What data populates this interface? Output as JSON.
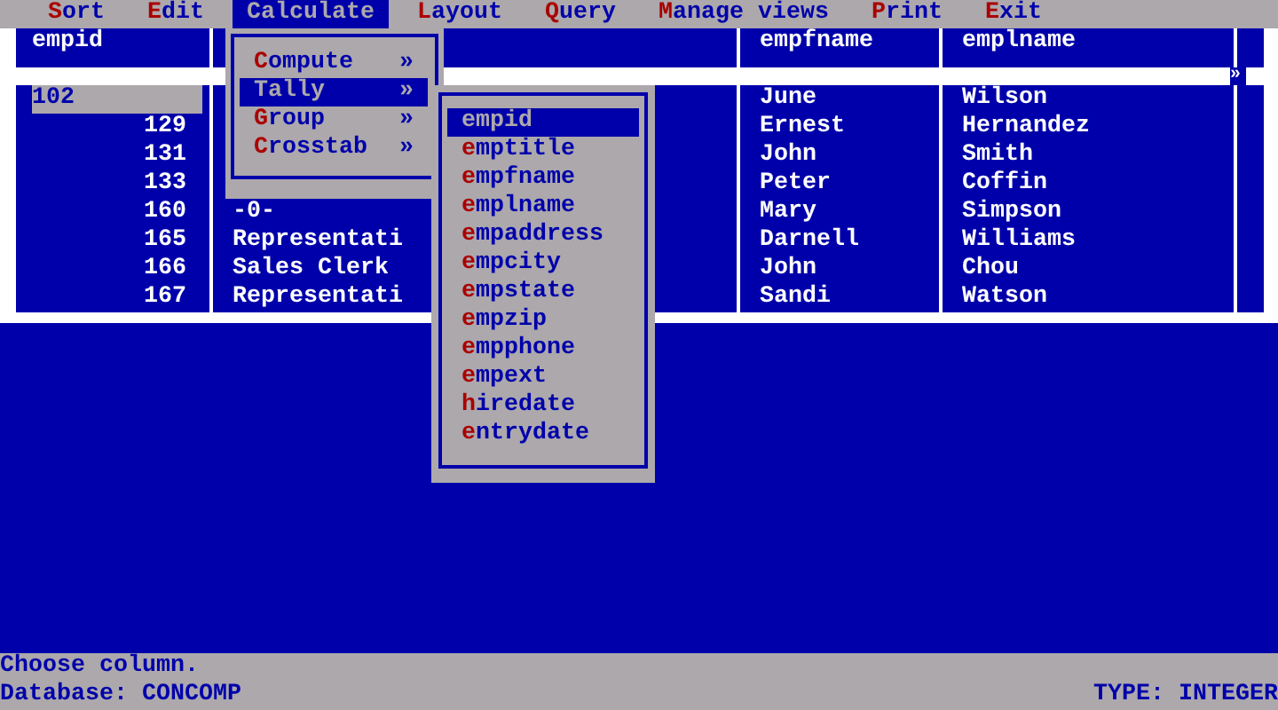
{
  "menu_bar": [
    {
      "label": "Sort",
      "selected": false
    },
    {
      "label": "Edit",
      "selected": false
    },
    {
      "label": "Calculate",
      "selected": true
    },
    {
      "label": "Layout",
      "selected": false
    },
    {
      "label": "Query",
      "selected": false
    },
    {
      "label": "Manage views",
      "selected": false
    },
    {
      "label": "Print",
      "selected": false
    },
    {
      "label": "Exit",
      "selected": false
    }
  ],
  "table": {
    "columns": [
      "empid",
      "",
      "empfname",
      "emplname"
    ],
    "scroll_indicator": "»",
    "rows": [
      {
        "empid": "102",
        "column_2": "",
        "empfname": "June",
        "emplname": "Wilson",
        "selected": true
      },
      {
        "empid": "129",
        "column_2": "",
        "empfname": "Ernest",
        "emplname": "Hernandez",
        "selected": false
      },
      {
        "empid": "131",
        "column_2": "",
        "empfname": "John",
        "emplname": "Smith",
        "selected": false
      },
      {
        "empid": "133",
        "column_2": "",
        "empfname": "Peter",
        "emplname": "Coffin",
        "selected": false
      },
      {
        "empid": "160",
        "column_2": "-0-",
        "empfname": "Mary",
        "emplname": "Simpson",
        "selected": false
      },
      {
        "empid": "165",
        "column_2": "Representati",
        "empfname": "Darnell",
        "emplname": "Williams",
        "selected": false
      },
      {
        "empid": "166",
        "column_2": "Sales Clerk",
        "empfname": "John",
        "emplname": "Chou",
        "selected": false
      },
      {
        "empid": "167",
        "column_2": "Representati",
        "empfname": "Sandi",
        "emplname": "Watson",
        "selected": false
      }
    ]
  },
  "calculate_menu": [
    {
      "label": "Compute",
      "arrow": "»",
      "selected": false
    },
    {
      "label": "Tally",
      "arrow": "»",
      "selected": true
    },
    {
      "label": "Group",
      "arrow": "»",
      "selected": false
    },
    {
      "label": "Crosstab",
      "arrow": "»",
      "selected": false
    }
  ],
  "tally_submenu": [
    {
      "label": "empid",
      "selected": true
    },
    {
      "label": "emptitle",
      "selected": false
    },
    {
      "label": "empfname",
      "selected": false
    },
    {
      "label": "emplname",
      "selected": false
    },
    {
      "label": "empaddress",
      "selected": false
    },
    {
      "label": "empcity",
      "selected": false
    },
    {
      "label": "empstate",
      "selected": false
    },
    {
      "label": "empzip",
      "selected": false
    },
    {
      "label": "empphone",
      "selected": false
    },
    {
      "label": "empext",
      "selected": false
    },
    {
      "label": "hiredate",
      "selected": false
    },
    {
      "label": "entrydate",
      "selected": false
    }
  ],
  "status_bar": {
    "message": "Choose column.",
    "database": "Database: CONCOMP",
    "type": "TYPE: INTEGER"
  }
}
